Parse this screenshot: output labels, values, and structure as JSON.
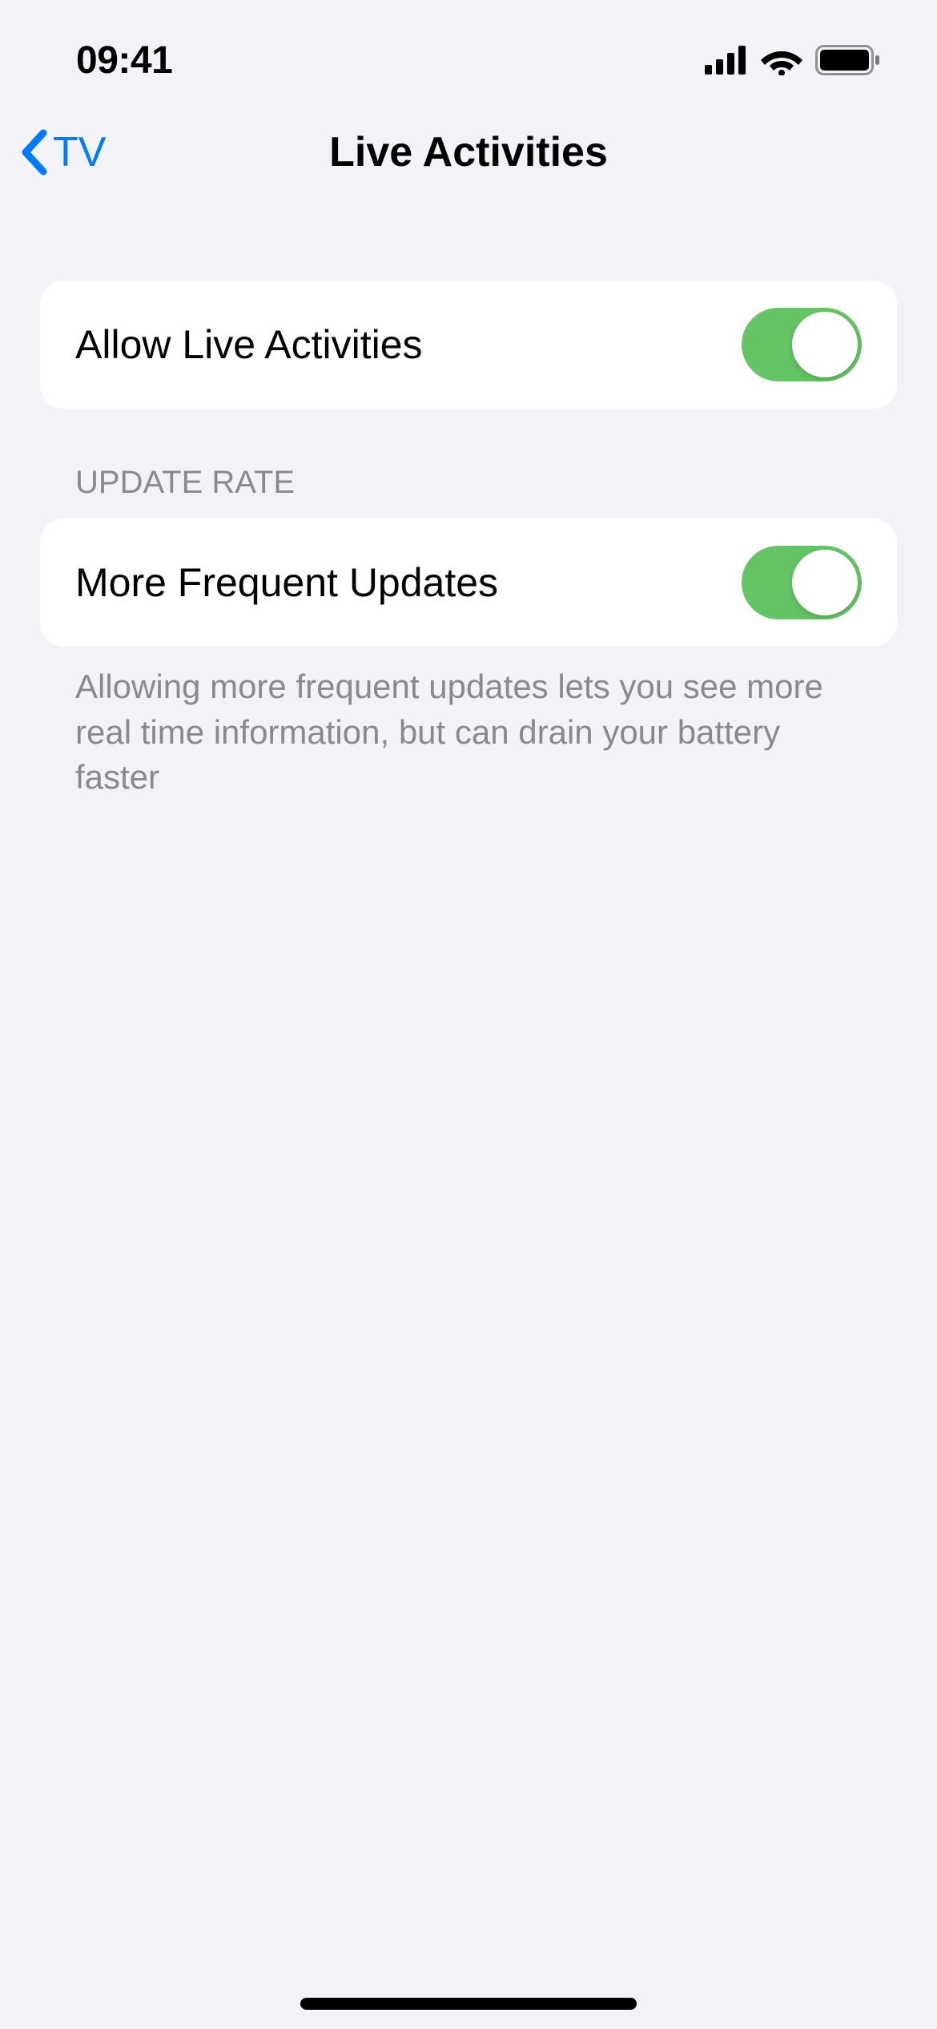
{
  "statusBar": {
    "time": "09:41"
  },
  "nav": {
    "backLabel": "TV",
    "title": "Live Activities"
  },
  "groups": [
    {
      "header": null,
      "rows": [
        {
          "label": "Allow Live Activities",
          "switchOn": true
        }
      ],
      "footer": null
    },
    {
      "header": "UPDATE RATE",
      "rows": [
        {
          "label": "More Frequent Updates",
          "switchOn": true
        }
      ],
      "footer": "Allowing more frequent updates lets you see more real time information, but can drain your battery faster"
    }
  ]
}
